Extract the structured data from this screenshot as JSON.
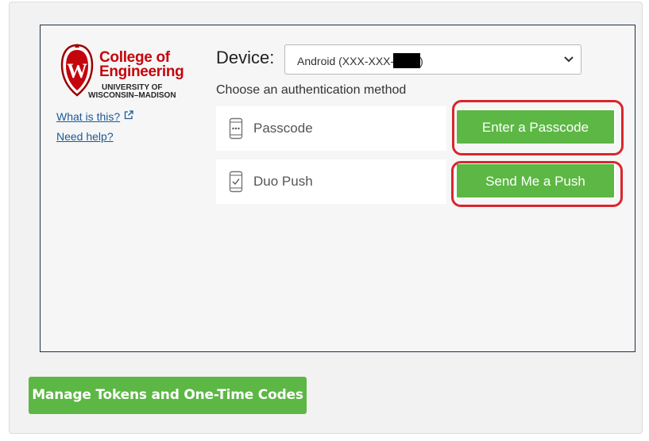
{
  "brand": {
    "line1": "College of",
    "line2": "Engineering",
    "line3": "UNIVERSITY OF",
    "line4": "WISCONSIN–MADISON",
    "crest_letter": "W",
    "crest_icon": "uw-crest-icon",
    "color": "#c5050c"
  },
  "links": {
    "what_is_this": "What is this?",
    "what_is_this_icon": "external-link-icon",
    "need_help": "Need help?"
  },
  "device": {
    "label": "Device:",
    "value_prefix": "Android (XXX-XXX-",
    "value_suffix": ")",
    "chevron_icon": "chevron-down-icon"
  },
  "auth": {
    "prompt": "Choose an authentication method",
    "methods": [
      {
        "label": "Passcode",
        "icon": "passcode-phone-icon",
        "button": "Enter a Passcode"
      },
      {
        "label": "Duo Push",
        "icon": "push-phone-icon",
        "button": "Send Me a Push"
      }
    ]
  },
  "footer": {
    "manage_label": "Manage Tokens and One-Time Codes"
  },
  "colors": {
    "accent_green": "#5cb744",
    "highlight_red": "#d9262e",
    "link_blue": "#1a5a9a",
    "frame_border": "#1f3144"
  }
}
